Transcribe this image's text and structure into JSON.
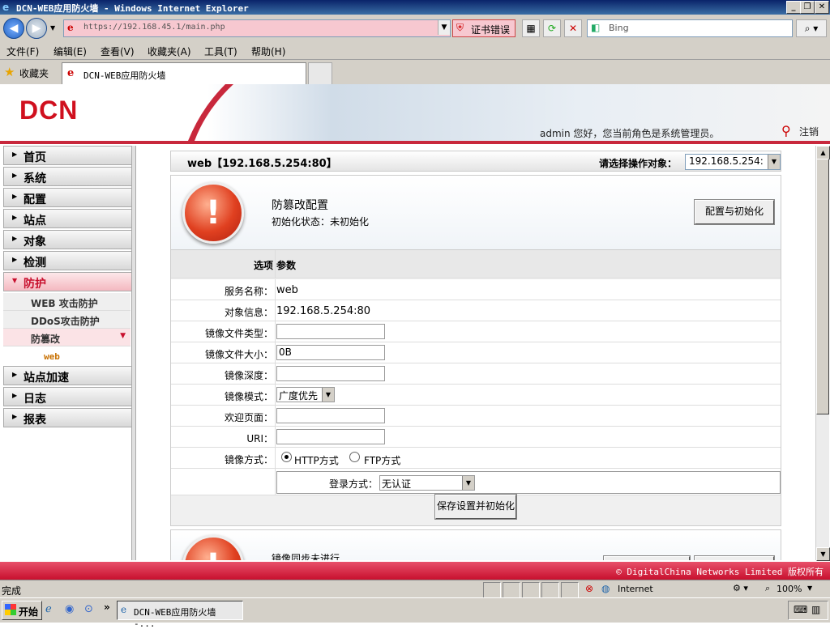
{
  "window": {
    "title": "DCN-WEB应用防火墙 - Windows Internet Explorer"
  },
  "address": {
    "url": "https://192.168.45.1/main.php",
    "cert_error": "证书错误",
    "search_placeholder": "Bing"
  },
  "menu": [
    "文件(F)",
    "编辑(E)",
    "查看(V)",
    "收藏夹(A)",
    "工具(T)",
    "帮助(H)"
  ],
  "favorites": {
    "label": "收藏夹",
    "tab_title": "DCN-WEB应用防火墙"
  },
  "header": {
    "logo": "DCN",
    "welcome": "admin 您好，您当前角色是系统管理员。",
    "logout": "注销"
  },
  "sidebar": {
    "items": [
      "首页",
      "系统",
      "配置",
      "站点",
      "对象",
      "检测",
      "防护",
      "站点加速",
      "日志",
      "报表"
    ],
    "sub_items": [
      "WEB 攻击防护",
      "DDoS攻击防护",
      "防篡改"
    ],
    "sub_sub_items": [
      "web"
    ]
  },
  "main": {
    "section_title": "web【192.168.5.254:80】",
    "target_label": "请选择操作对象：",
    "target_value": "192.168.5.254:",
    "card": {
      "title": "防篡改配置",
      "status": "初始化状态：未初始化",
      "button": "配置与初始化"
    },
    "table": {
      "headers": {
        "option": "选项",
        "param": "参数"
      },
      "service_name": {
        "label": "服务名称：",
        "value": "web"
      },
      "object_info": {
        "label": "对象信息：",
        "value": "192.168.5.254:80"
      },
      "mirror_file_type": {
        "label": "镜像文件类型：",
        "value": ""
      },
      "mirror_file_size": {
        "label": "镜像文件大小：",
        "value": "0B"
      },
      "mirror_depth": {
        "label": "镜像深度：",
        "value": ""
      },
      "mirror_mode": {
        "label": "镜像模式：",
        "value": "广度优先"
      },
      "welcome_page": {
        "label": "欢迎页面：",
        "value": ""
      },
      "uri": {
        "label": "URI：",
        "value": ""
      },
      "mirror_method": {
        "label": "镜像方式：",
        "option_http": "HTTP方式",
        "option_ftp": "FTP方式"
      },
      "login_method": {
        "label": "登录方式：",
        "value": "无认证"
      },
      "save_button": "保存设置并初始化"
    },
    "card2": {
      "title": "镜像同步未进行"
    }
  },
  "footer": {
    "copyright": "© DigitalChina Networks Limited 版权所有"
  },
  "status": {
    "text": "完成",
    "zone": "Internet",
    "zoom": "100%"
  },
  "taskbar": {
    "start": "开始",
    "item": "DCN-WEB应用防火墙 -..."
  }
}
